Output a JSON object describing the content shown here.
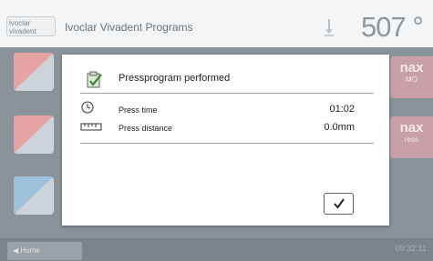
{
  "header": {
    "logo_text_line1": "ivoclar",
    "logo_text_line2": "vivadent",
    "title": "Ivoclar Vivadent Programs",
    "temperature": "507 °"
  },
  "tiles_right": [
    {
      "main": "nax",
      "sub": "MO"
    },
    {
      "main": "nax",
      "sub": "ress"
    }
  ],
  "dialog": {
    "title": "Pressprogram performed",
    "rows": [
      {
        "icon": "clock-icon",
        "label": "Press time",
        "value": "01:02"
      },
      {
        "icon": "ruler-icon",
        "label": "Press distance",
        "value": "0.0mm"
      }
    ],
    "confirm_icon": "checkmark-icon"
  },
  "footer": {
    "home_label": "Home",
    "time": "09:32:11"
  }
}
